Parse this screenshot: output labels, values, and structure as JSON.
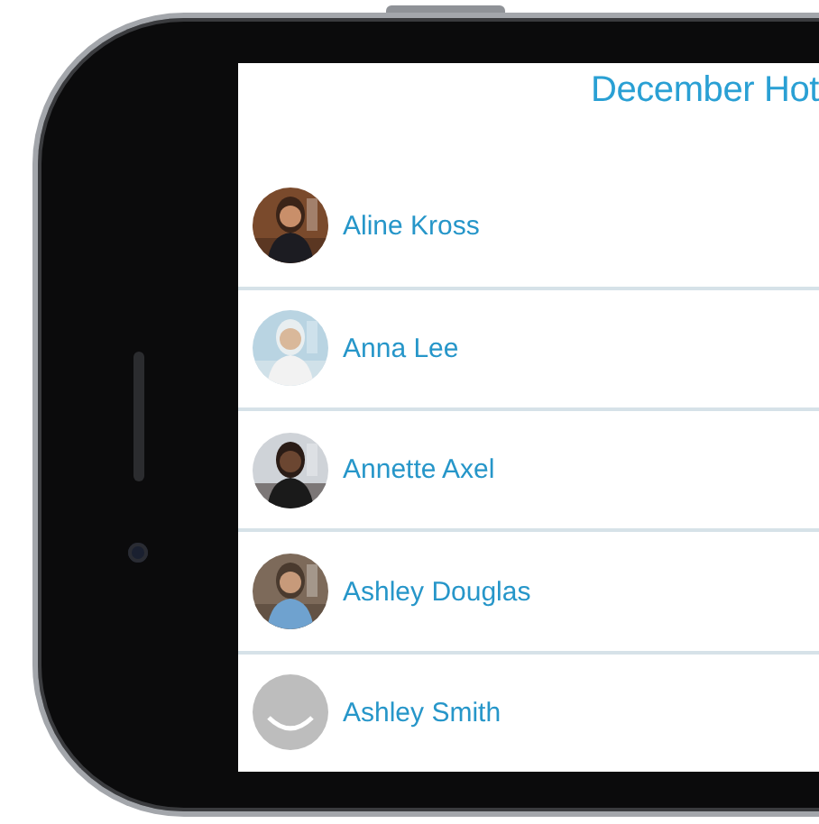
{
  "screen": {
    "title": "December Hot",
    "contacts": [
      {
        "name": "Aline Kross"
      },
      {
        "name": "Anna Lee"
      },
      {
        "name": "Annette Axel"
      },
      {
        "name": "Ashley Douglas"
      },
      {
        "name": "Ashley Smith",
        "avatar": {
          "kind": "placeholder"
        }
      }
    ]
  }
}
